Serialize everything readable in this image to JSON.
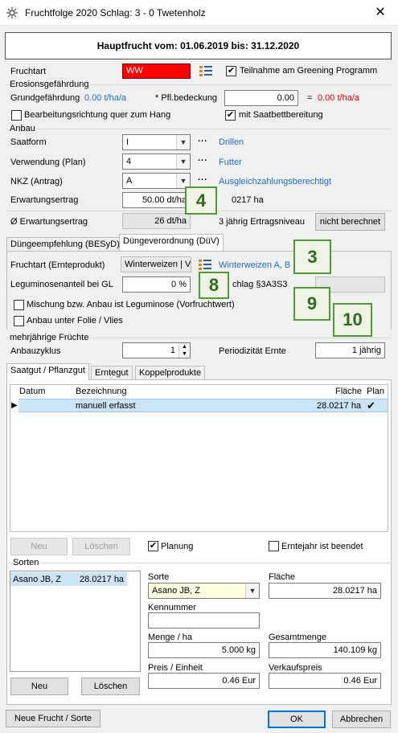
{
  "window": {
    "title": "Fruchtfolge 2020 Schlag: 3 - 0 Twetenholz",
    "close": "✕"
  },
  "header": "Hauptfrucht vom: 01.06.2019 bis: 31.12.2020",
  "fruchtart": {
    "label": "Fruchtart",
    "value": "WW",
    "greening_label": "Teilnahme am Greening Programm",
    "greening_checked": "✔"
  },
  "erosion": {
    "group_title": "Erosionsgefährdung",
    "grund_label": "Grundgefährdung",
    "grund_value": "0.00 t/ha/a",
    "pfl_label": "* Pfl.bedeckung",
    "pfl_value": "0.00",
    "eq": "=",
    "result": "0.00 t/ha/a",
    "bearbeitung_label": "Bearbeitungsrichtung quer zum Hang",
    "saatbett_label": "mit Saatbettbereitung",
    "saatbett_checked": "✔"
  },
  "anbau": {
    "group_title": "Anbau",
    "saatform_label": "Saatform",
    "saatform_value": "I",
    "saatform_desc": "Drillen",
    "verwendung_label": "Verwendung (Plan)",
    "verwendung_value": "4",
    "verwendung_desc": "Futter",
    "nkz_label": "NKZ  (Antrag)",
    "nkz_value": "A",
    "nkz_desc": "Ausgleichzahlungsberechtigt",
    "dots": "...",
    "ertrag_label": "Erwartungsertrag",
    "ertrag_value": "50.00 dt/ha",
    "ertrag_side": "0217 ha",
    "avg_label": "Ø Erwartungsertrag",
    "avg_value": "26 dt/ha",
    "niveau_label": "3 jährig Ertragsniveau",
    "niveau_button": "nicht berechnet"
  },
  "tabs_top": [
    "Düngeempfehlung (BESyD)",
    "Düngeverordnung (DüV)"
  ],
  "duev": {
    "frucht_label": "Fruchtart (Ernteprodukt)",
    "frucht_value": "Winterweizen | V",
    "frucht_desc": "Winterweizen A, B",
    "legum_label": "Leguminosenanteil bei GL",
    "legum_value": "0 %",
    "zuschlag_label": "chlag §3A3S3",
    "mischung_label": "Mischung bzw. Anbau ist Leguminose (Vorfruchtwert)",
    "folie_label": "Anbau unter Folie / Vlies"
  },
  "badges": {
    "b4": "4",
    "b3": "3",
    "b8": "8",
    "b9": "9",
    "b10": "10"
  },
  "mehrjaehrig": {
    "group_title": "mehrjährige Früchte",
    "zyklus_label": "Anbauzyklus",
    "zyklus_value": "1",
    "periodizitaet_label": "Periodizität Ernte",
    "periodizitaet_value": "1 jährig"
  },
  "tabs_bottom": [
    "Saatgut / Pflanzgut",
    "Erntegut",
    "Koppelprodukte"
  ],
  "grid": {
    "columns": [
      "Datum",
      "Bezeichnung",
      "Fläche",
      "Plan"
    ],
    "rows": [
      {
        "marker": "▶",
        "datum": "",
        "bezeichnung": "manuell erfasst",
        "flaeche": "28.0217 ha",
        "plan": "✔"
      }
    ]
  },
  "grid_actions": {
    "neu": "Neu",
    "loeschen": "Löschen",
    "planung_label": "Planung",
    "planung_checked": "✔",
    "erntejahr_label": "Erntejahr ist beendet"
  },
  "sorten": {
    "group_title": "Sorten",
    "list": [
      {
        "name": "Asano JB, Z",
        "flaeche": "28.0217 ha"
      }
    ],
    "sorte_label": "Sorte",
    "sorte_value": "Asano JB, Z",
    "flaeche_label": "Fläche",
    "flaeche_value": "28.0217 ha",
    "kennnummer_label": "Kennummer",
    "kennnummer_value": "",
    "menge_label": "Menge / ha",
    "menge_value": "5.000 kg",
    "gesamt_label": "Gesamtmenge",
    "gesamt_value": "140.109 kg",
    "preis_label": "Preis / Einheit",
    "preis_value": "0.46 Eur",
    "vk_label": "Verkaufspreis",
    "vk_value": "0.46 Eur",
    "neu": "Neu",
    "loeschen": "Löschen"
  },
  "footer": {
    "neue_frucht": "Neue Frucht / Sorte",
    "ok": "OK",
    "abbrechen": "Abbrechen"
  },
  "colors": {
    "fruchtart_bg": "#ff0000",
    "badge_border": "#4f9a34",
    "link": "#1a6fc0",
    "result": "#e00000",
    "selection": "#cce4f7",
    "sorte_input_bg": "#ffffe1"
  }
}
